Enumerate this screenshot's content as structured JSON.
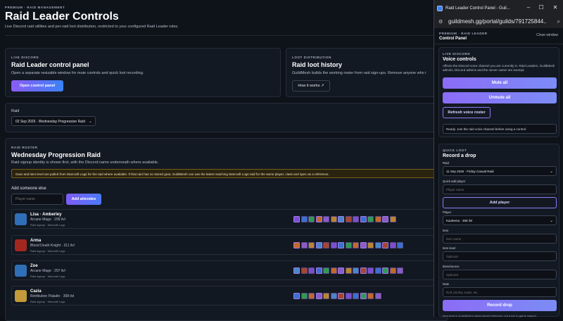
{
  "header": {
    "eyebrow": "PREMIUM · RAID MANAGEMENT",
    "title": "Raid Leader Controls",
    "subtitle": "Live Discord raid utilities and per-raid loot distribution, restricted to your configured Raid Leader roles."
  },
  "live_card": {
    "eyebrow": "LIVE DISCORD",
    "title": "Raid Leader control panel",
    "desc": "Open a separate resizable window for mute controls and quick loot recording.",
    "button": "Open control panel"
  },
  "loot_card": {
    "eyebrow": "LOOT DISTRIBUTION",
    "title": "Raid loot history",
    "desc": "GuildMesh builds the working roster from raid sign-ups. Remove anyone who i",
    "button": "How it works ↗"
  },
  "raid_picker": {
    "label": "Raid",
    "selected": "02 Sep 2026 · Wednesday Progression Raid"
  },
  "roster": {
    "eyebrow": "RAID ROSTER",
    "title": "Wednesday Progression Raid",
    "desc": "Raid signup identity is shown first, with the Discord name underneath where available.",
    "note": "Gear and item level are pulled from Warcraft Logs for the raid where available. If that raid has no stored gear, GuildMesh can use the latest matching Warcraft Logs raid for the same player, class and spec as a reference.",
    "add_label": "Add someone else",
    "input_placeholder": "Player name",
    "add_button": "Add attendee",
    "players": [
      {
        "name": "Lisa · Amberley",
        "class": "Arcane Mage · 299 ilvl",
        "source": "Raid signup · Warcraft Logs",
        "avatar_color": "#2f6fb8",
        "gear_count": 14
      },
      {
        "name": "Arma",
        "class": "Blood Death Knight · 311 ilvl",
        "source": "Raid signup · Warcraft Logs",
        "avatar_color": "#a3271f",
        "gear_count": 15
      },
      {
        "name": "Zoe",
        "class": "Arcane Mage · 297 ilvl",
        "source": "Raid signup · Warcraft Logs",
        "avatar_color": "#2f6fb8",
        "gear_count": 15
      },
      {
        "name": "Cazia",
        "class": "Retribution Paladin · 308 ilvl",
        "source": "Raid signup · Warcraft Logs",
        "avatar_color": "#c49a3a",
        "gear_count": 12
      }
    ]
  },
  "popup": {
    "window_title": "Raid Leader Control Panel - Guil...",
    "url": "guildmesh.gg/portal/guilds/791725844...",
    "eyebrow": "PREMIUM · RAID LEADER",
    "heading": "Control Panel",
    "close_label": "Close window",
    "voice": {
      "eyebrow": "LIVE DISCORD",
      "title": "Voice controls",
      "desc": "Affects the Discord voice channel you are currently in. Raid Leaders, GuildMesh admins, Discord admins and the server owner are exempt.",
      "mute_all": "Mute all",
      "unmute_all": "Unmute all",
      "refresh": "Refresh voice roster",
      "status": "Ready. Join the raid voice channel before using a control."
    },
    "quick_loot": {
      "eyebrow": "QUICK LOOT",
      "title": "Record a drop",
      "raid_label": "Raid",
      "raid_selected": "11 Sep 2026 · Friday Casual Raid",
      "quick_add_label": "Quick add player",
      "player_name_placeholder": "Player name",
      "add_player": "Add player",
      "player_label": "Player",
      "player_selected": "Kaoleena · 308 ilvl",
      "item_label": "Item",
      "item_placeholder": "Item name",
      "ilvl_label": "Item level",
      "ilvl_placeholder": "Optional",
      "boss_label": "Boss/source",
      "boss_placeholder": "Optional",
      "note_label": "Note",
      "note_placeholder": "Roll, priority, trade, etc.",
      "record_button": "Record drop",
      "footnote": "Item level is GuildMesh's latest stored reference, not a live in-game inspect."
    }
  },
  "gear_colors": [
    "#7a4fd0",
    "#3b6fd0",
    "#2e9a55",
    "#c2682a",
    "#8a5cc4",
    "#b8862f",
    "#4a86c8",
    "#a8452f"
  ]
}
